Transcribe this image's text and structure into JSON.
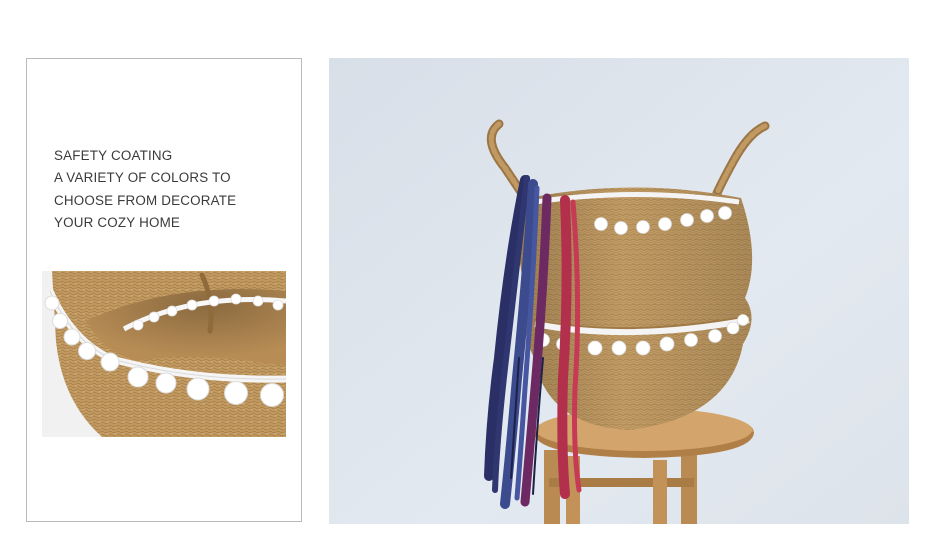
{
  "description": {
    "lines": [
      "SAFETY COATING",
      "A VARIETY OF COLORS TO",
      "CHOOSE FROM DECORATE",
      "YOUR COZY HOME"
    ]
  },
  "images": {
    "detail": {
      "subject": "basket-rim-pompom-detail"
    },
    "main": {
      "subject": "seagrass-basket-on-stool"
    }
  },
  "colors": {
    "background": "#ffffff",
    "panel_border": "#b9b9b9",
    "text": "#3a3a3a",
    "wall": "#dfe6ee",
    "seagrass": "#c09a62",
    "stool": "#c79a63",
    "pompom": "#ffffff",
    "tassel_navy": "#2a2f66",
    "tassel_blue": "#3c4a8e",
    "tassel_purple": "#6d2a62",
    "tassel_red": "#b2304c"
  }
}
